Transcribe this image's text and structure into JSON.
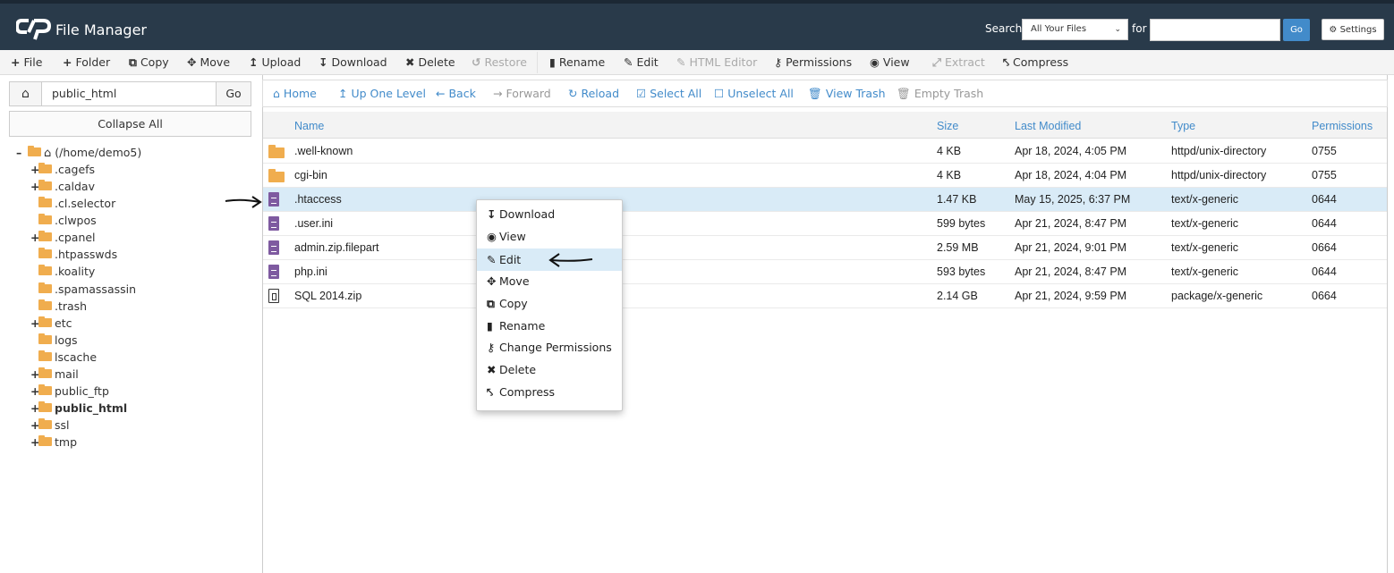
{
  "app": {
    "title": "File Manager"
  },
  "search": {
    "label": "Search",
    "scope": "All Your Files",
    "for_label": "for",
    "value": "",
    "go_label": "Go",
    "settings_label": "Settings"
  },
  "toolbar": {
    "file": "File",
    "folder": "Folder",
    "copy": "Copy",
    "move": "Move",
    "upload": "Upload",
    "download": "Download",
    "delete": "Delete",
    "restore": "Restore",
    "rename": "Rename",
    "edit": "Edit",
    "html_editor": "HTML Editor",
    "permissions": "Permissions",
    "view": "View",
    "extract": "Extract",
    "compress": "Compress"
  },
  "sidebar": {
    "path_value": "public_html",
    "go_label": "Go",
    "collapse_label": "Collapse All",
    "root": "(/home/demo5)",
    "items": [
      {
        "label": ".cagefs",
        "expander": "+"
      },
      {
        "label": ".caldav",
        "expander": "+"
      },
      {
        "label": ".cl.selector",
        "expander": ""
      },
      {
        "label": ".clwpos",
        "expander": ""
      },
      {
        "label": ".cpanel",
        "expander": "+"
      },
      {
        "label": ".htpasswds",
        "expander": ""
      },
      {
        "label": ".koality",
        "expander": ""
      },
      {
        "label": ".spamassassin",
        "expander": ""
      },
      {
        "label": ".trash",
        "expander": ""
      },
      {
        "label": "etc",
        "expander": "+"
      },
      {
        "label": "logs",
        "expander": ""
      },
      {
        "label": "lscache",
        "expander": ""
      },
      {
        "label": "mail",
        "expander": "+"
      },
      {
        "label": "public_ftp",
        "expander": "+"
      },
      {
        "label": "public_html",
        "expander": "+"
      },
      {
        "label": "ssl",
        "expander": "+"
      },
      {
        "label": "tmp",
        "expander": "+"
      }
    ]
  },
  "nav": {
    "home": "Home",
    "up": "Up One Level",
    "back": "Back",
    "forward": "Forward",
    "reload": "Reload",
    "select_all": "Select All",
    "unselect_all": "Unselect All",
    "view_trash": "View Trash",
    "empty_trash": "Empty Trash"
  },
  "table": {
    "headers": {
      "name": "Name",
      "size": "Size",
      "modified": "Last Modified",
      "type": "Type",
      "perms": "Permissions"
    },
    "rows": [
      {
        "icon": "folder-icon",
        "name": ".well-known",
        "size": "4 KB",
        "modified": "Apr 18, 2024, 4:05 PM",
        "type": "httpd/unix-directory",
        "perms": "0755"
      },
      {
        "icon": "folder-icon",
        "name": "cgi-bin",
        "size": "4 KB",
        "modified": "Apr 18, 2024, 4:04 PM",
        "type": "httpd/unix-directory",
        "perms": "0755"
      },
      {
        "icon": "file-icon",
        "name": ".htaccess",
        "size": "1.47 KB",
        "modified": "May 15, 2025, 6:37 PM",
        "type": "text/x-generic",
        "perms": "0644"
      },
      {
        "icon": "file-icon",
        "name": ".user.ini",
        "size": "599 bytes",
        "modified": "Apr 21, 2024, 8:47 PM",
        "type": "text/x-generic",
        "perms": "0644"
      },
      {
        "icon": "file-icon",
        "name": "admin.zip.filepart",
        "size": "2.59 MB",
        "modified": "Apr 21, 2024, 9:01 PM",
        "type": "text/x-generic",
        "perms": "0664"
      },
      {
        "icon": "file-icon",
        "name": "php.ini",
        "size": "593 bytes",
        "modified": "Apr 21, 2024, 8:47 PM",
        "type": "text/x-generic",
        "perms": "0644"
      },
      {
        "icon": "zip-icon",
        "name": "SQL 2014.zip",
        "size": "2.14 GB",
        "modified": "Apr 21, 2024, 9:59 PM",
        "type": "package/x-generic",
        "perms": "0664"
      }
    ]
  },
  "context_menu": {
    "items": [
      "Download",
      "View",
      "Edit",
      "Move",
      "Copy",
      "Rename",
      "Change Permissions",
      "Delete",
      "Compress"
    ]
  },
  "colors": {
    "header_bg": "#293a4a",
    "accent": "#428bca",
    "folder": "#f0ad4e",
    "file": "#7e5aa0",
    "selected_row": "#d9ebf7"
  }
}
